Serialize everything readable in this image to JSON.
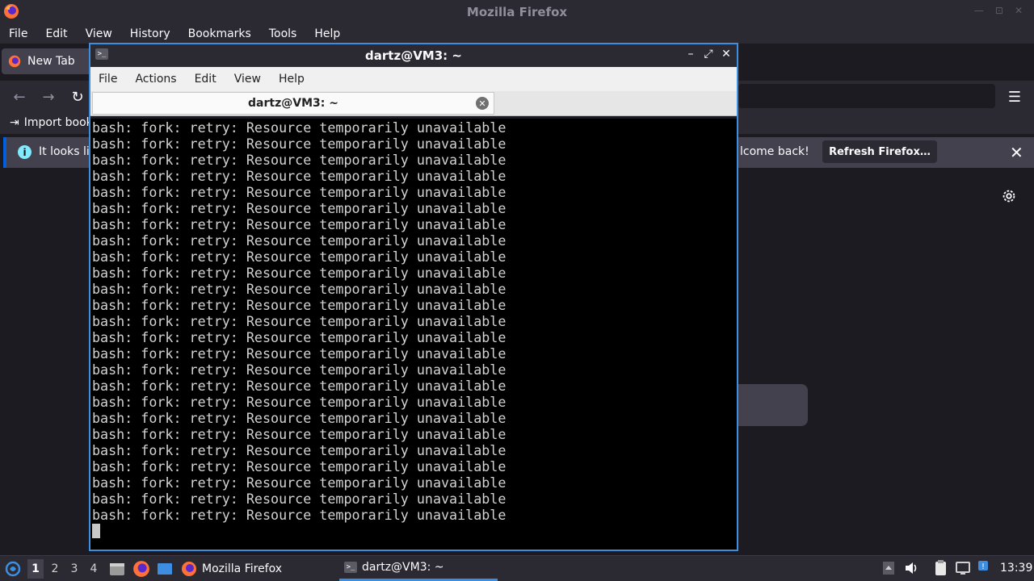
{
  "firefox": {
    "window_title": "Mozilla Firefox",
    "menu": [
      "File",
      "Edit",
      "View",
      "History",
      "Bookmarks",
      "Tools",
      "Help"
    ],
    "tab_label": "New Tab",
    "bookmarks_import_label": "Import book",
    "notice": {
      "text_left": "It looks lik",
      "text_right": "lcome back!",
      "refresh_label": "Refresh Firefox…"
    }
  },
  "terminal": {
    "window_title": "dartz@VM3: ~",
    "menu": [
      "File",
      "Actions",
      "Edit",
      "View",
      "Help"
    ],
    "tab_label": "dartz@VM3: ~",
    "output_line": "bash: fork: retry: Resource temporarily unavailable",
    "output_line_count": 25
  },
  "taskbar": {
    "workspaces": [
      "1",
      "2",
      "3",
      "4"
    ],
    "active_workspace": "1",
    "tasks": [
      {
        "label": "Mozilla Firefox",
        "icon": "firefox-icon",
        "active": false
      },
      {
        "label": "dartz@VM3: ~",
        "icon": "terminal-icon",
        "active": true
      }
    ],
    "clock": "13:39"
  },
  "colors": {
    "accent": "#3d8ee0",
    "terminal_text": "#d3d3d3",
    "firefox_bg": "#1c1b22"
  }
}
